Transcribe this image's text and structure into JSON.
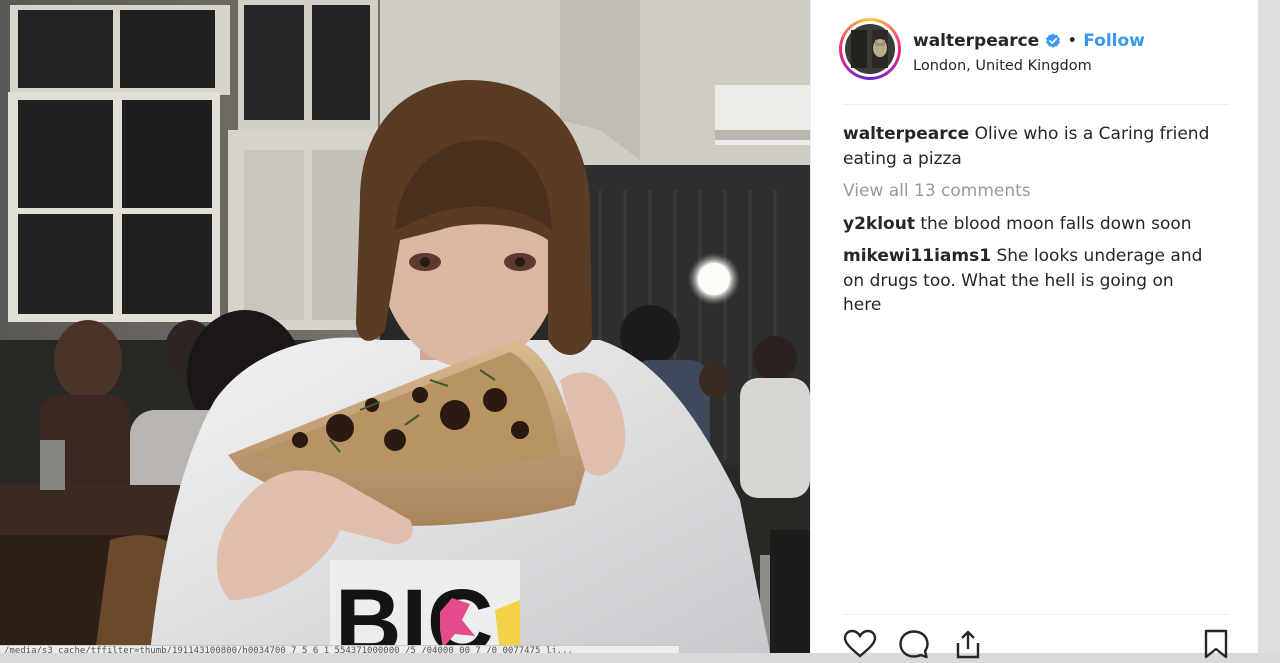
{
  "post": {
    "username": "walterpearce",
    "follow_label": "Follow",
    "separator": "•",
    "location": "London, United Kingdom",
    "caption_user": "walterpearce",
    "caption_text": "Olive who is a Caring friend eating a pizza",
    "view_all_label": "View all 13 comments",
    "comments": [
      {
        "user": "y2klout",
        "text": "the blood moon falls down soon"
      },
      {
        "user": "mikewi11iams1",
        "text": "She looks underage and on drugs too. What the hell is going on here"
      }
    ]
  },
  "icons": {
    "verified": "verified-badge-icon",
    "like": "heart-icon",
    "comment": "comment-icon",
    "share": "share-icon",
    "save": "bookmark-icon"
  },
  "colors": {
    "accent": "#3897f0",
    "muted": "#999999",
    "text": "#262626"
  },
  "browser": {
    "status_url": "/media/s3_cache/tffilter=thumb/191143100800/h0034700_7_5_6_1_554371000000_/5_/04000_00_7_/0_0077475_lj..."
  }
}
